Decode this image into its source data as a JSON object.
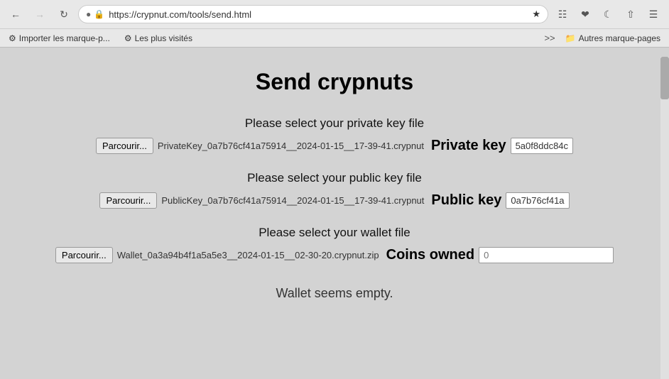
{
  "browser": {
    "url": "https://crypnut.com/tools/send.html",
    "back_disabled": false,
    "forward_disabled": false,
    "bookmarks": [
      {
        "label": "Importer les marque-p..."
      },
      {
        "label": "Les plus visités"
      }
    ],
    "bookmarks_overflow": ">>",
    "other_bookmarks": "Autres marque-pages"
  },
  "page": {
    "title": "Send crypnuts",
    "sections": [
      {
        "id": "private-key",
        "heading": "Please select your private key file",
        "browse_label": "Parcourir...",
        "file_name": "PrivateKey_0a7b76cf41a75914__2024-01-15__17-39-41.crypnut",
        "key_label": "Private key",
        "key_value": "5a0f8ddc84c"
      },
      {
        "id": "public-key",
        "heading": "Please select your public key file",
        "browse_label": "Parcourir...",
        "file_name": "PublicKey_0a7b76cf41a75914__2024-01-15__17-39-41.crypnut",
        "key_label": "Public key",
        "key_value": "0a7b76cf41a"
      },
      {
        "id": "wallet",
        "heading": "Please select your wallet file",
        "browse_label": "Parcourir...",
        "file_name": "Wallet_0a3a94b4f1a5a5e3__2024-01-15__02-30-20.crypnut.zip",
        "key_label": "Coins owned",
        "coins_placeholder": "0"
      }
    ],
    "wallet_status": "Wallet seems empty."
  }
}
